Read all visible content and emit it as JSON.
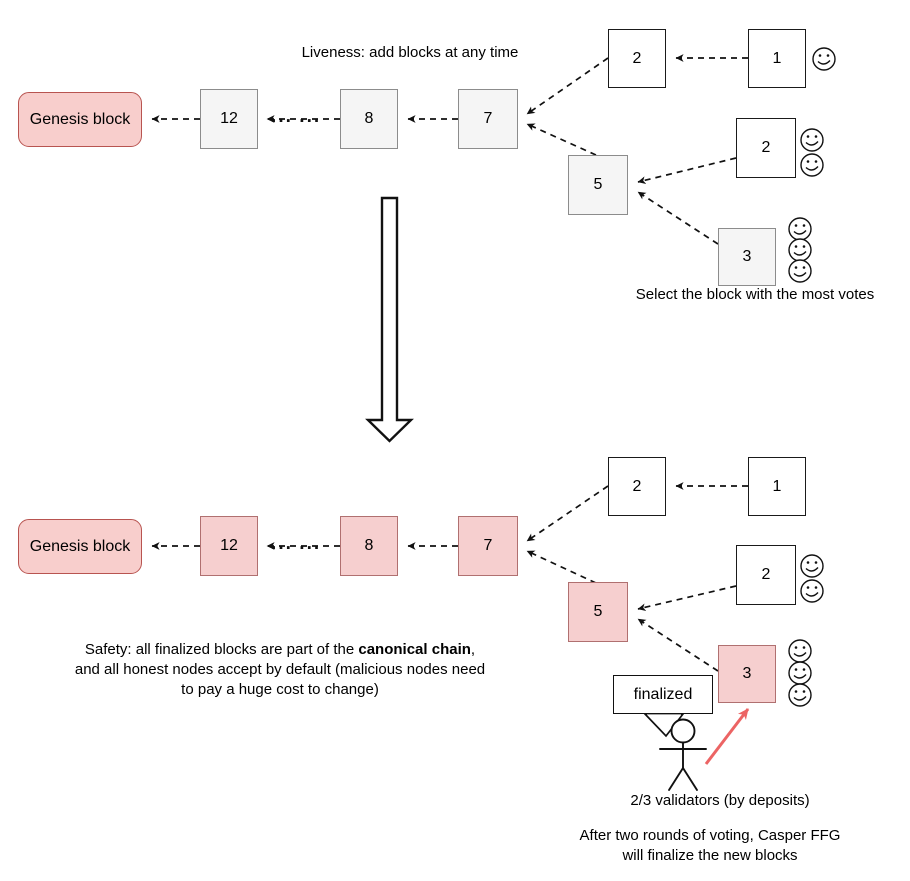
{
  "diagram": {
    "title": "Casper FFG liveness and safety diagram",
    "colors": {
      "pink_fill": "#f6cfcf",
      "pink_border": "#b07070",
      "genesis_fill": "#f8cecc",
      "genesis_border": "#b85450",
      "grey_fill": "#f5f5f5",
      "grey_border": "#8c8c8c",
      "white_fill": "#ffffff",
      "black_border": "#1a1a1a",
      "red_arrow": "#ec6464"
    },
    "ellipsis": "··· ···"
  },
  "top_section": {
    "caption_liveness": "Liveness: add blocks at any time",
    "caption_votes": "Select the block with the most votes",
    "genesis_label": "Genesis block",
    "chain_blocks": [
      {
        "label": "12"
      },
      {
        "label": "8"
      },
      {
        "label": "7"
      }
    ],
    "fork_blocks": [
      {
        "label": "2",
        "votes": 0
      },
      {
        "label": "1",
        "votes": 1
      },
      {
        "label": "5",
        "votes": 0
      },
      {
        "label": "2",
        "votes": 2
      },
      {
        "label": "3",
        "votes": 3
      }
    ]
  },
  "bottom_section": {
    "genesis_label": "Genesis block",
    "caption_safety_line1_a": "Safety: all finalized blocks are part of the ",
    "caption_safety_line1_b": "canonical chain",
    "caption_safety_line1_c": ",",
    "caption_safety_line2": "and all honest nodes accept by default (malicious nodes need",
    "caption_safety_line3": "to pay a huge cost to change)",
    "caption_validators": "2/3 validators (by deposits)",
    "caption_casper_line1": "After two rounds of voting, Casper FFG",
    "caption_casper_line2": "will finalize the new blocks",
    "bubble_text": "finalized",
    "chain_blocks": [
      {
        "label": "12"
      },
      {
        "label": "8"
      },
      {
        "label": "7"
      }
    ],
    "fork_blocks": [
      {
        "label": "2",
        "votes": 0
      },
      {
        "label": "1",
        "votes": 0
      },
      {
        "label": "5",
        "votes": 0
      },
      {
        "label": "2",
        "votes": 2
      },
      {
        "label": "3",
        "votes": 3
      }
    ]
  }
}
